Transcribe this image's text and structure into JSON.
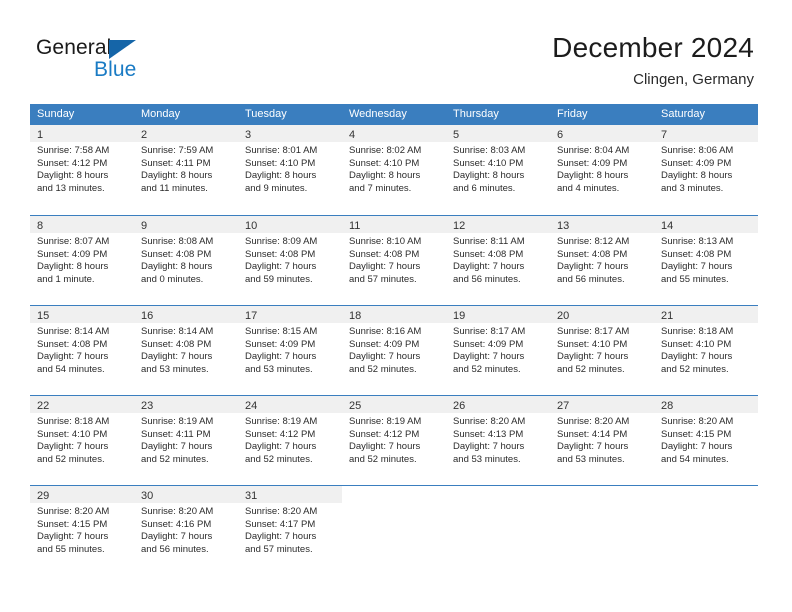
{
  "brand": {
    "name_part1": "General",
    "name_part2": "Blue",
    "triangle_icon": "triangle-icon",
    "color_dark": "#1a1a1a",
    "color_blue": "#1a7bc4"
  },
  "header": {
    "title": "December 2024",
    "subtitle": "Clingen, Germany"
  },
  "theme": {
    "header_bar": "#3a7ebf",
    "day_band": "#f0f0f0",
    "text": "#2b2b2b"
  },
  "weekdays": [
    "Sunday",
    "Monday",
    "Tuesday",
    "Wednesday",
    "Thursday",
    "Friday",
    "Saturday"
  ],
  "weeks": [
    [
      {
        "day": "1",
        "sunrise": "Sunrise: 7:58 AM",
        "sunset": "Sunset: 4:12 PM",
        "daylight1": "Daylight: 8 hours",
        "daylight2": "and 13 minutes."
      },
      {
        "day": "2",
        "sunrise": "Sunrise: 7:59 AM",
        "sunset": "Sunset: 4:11 PM",
        "daylight1": "Daylight: 8 hours",
        "daylight2": "and 11 minutes."
      },
      {
        "day": "3",
        "sunrise": "Sunrise: 8:01 AM",
        "sunset": "Sunset: 4:10 PM",
        "daylight1": "Daylight: 8 hours",
        "daylight2": "and 9 minutes."
      },
      {
        "day": "4",
        "sunrise": "Sunrise: 8:02 AM",
        "sunset": "Sunset: 4:10 PM",
        "daylight1": "Daylight: 8 hours",
        "daylight2": "and 7 minutes."
      },
      {
        "day": "5",
        "sunrise": "Sunrise: 8:03 AM",
        "sunset": "Sunset: 4:10 PM",
        "daylight1": "Daylight: 8 hours",
        "daylight2": "and 6 minutes."
      },
      {
        "day": "6",
        "sunrise": "Sunrise: 8:04 AM",
        "sunset": "Sunset: 4:09 PM",
        "daylight1": "Daylight: 8 hours",
        "daylight2": "and 4 minutes."
      },
      {
        "day": "7",
        "sunrise": "Sunrise: 8:06 AM",
        "sunset": "Sunset: 4:09 PM",
        "daylight1": "Daylight: 8 hours",
        "daylight2": "and 3 minutes."
      }
    ],
    [
      {
        "day": "8",
        "sunrise": "Sunrise: 8:07 AM",
        "sunset": "Sunset: 4:09 PM",
        "daylight1": "Daylight: 8 hours",
        "daylight2": "and 1 minute."
      },
      {
        "day": "9",
        "sunrise": "Sunrise: 8:08 AM",
        "sunset": "Sunset: 4:08 PM",
        "daylight1": "Daylight: 8 hours",
        "daylight2": "and 0 minutes."
      },
      {
        "day": "10",
        "sunrise": "Sunrise: 8:09 AM",
        "sunset": "Sunset: 4:08 PM",
        "daylight1": "Daylight: 7 hours",
        "daylight2": "and 59 minutes."
      },
      {
        "day": "11",
        "sunrise": "Sunrise: 8:10 AM",
        "sunset": "Sunset: 4:08 PM",
        "daylight1": "Daylight: 7 hours",
        "daylight2": "and 57 minutes."
      },
      {
        "day": "12",
        "sunrise": "Sunrise: 8:11 AM",
        "sunset": "Sunset: 4:08 PM",
        "daylight1": "Daylight: 7 hours",
        "daylight2": "and 56 minutes."
      },
      {
        "day": "13",
        "sunrise": "Sunrise: 8:12 AM",
        "sunset": "Sunset: 4:08 PM",
        "daylight1": "Daylight: 7 hours",
        "daylight2": "and 56 minutes."
      },
      {
        "day": "14",
        "sunrise": "Sunrise: 8:13 AM",
        "sunset": "Sunset: 4:08 PM",
        "daylight1": "Daylight: 7 hours",
        "daylight2": "and 55 minutes."
      }
    ],
    [
      {
        "day": "15",
        "sunrise": "Sunrise: 8:14 AM",
        "sunset": "Sunset: 4:08 PM",
        "daylight1": "Daylight: 7 hours",
        "daylight2": "and 54 minutes."
      },
      {
        "day": "16",
        "sunrise": "Sunrise: 8:14 AM",
        "sunset": "Sunset: 4:08 PM",
        "daylight1": "Daylight: 7 hours",
        "daylight2": "and 53 minutes."
      },
      {
        "day": "17",
        "sunrise": "Sunrise: 8:15 AM",
        "sunset": "Sunset: 4:09 PM",
        "daylight1": "Daylight: 7 hours",
        "daylight2": "and 53 minutes."
      },
      {
        "day": "18",
        "sunrise": "Sunrise: 8:16 AM",
        "sunset": "Sunset: 4:09 PM",
        "daylight1": "Daylight: 7 hours",
        "daylight2": "and 52 minutes."
      },
      {
        "day": "19",
        "sunrise": "Sunrise: 8:17 AM",
        "sunset": "Sunset: 4:09 PM",
        "daylight1": "Daylight: 7 hours",
        "daylight2": "and 52 minutes."
      },
      {
        "day": "20",
        "sunrise": "Sunrise: 8:17 AM",
        "sunset": "Sunset: 4:10 PM",
        "daylight1": "Daylight: 7 hours",
        "daylight2": "and 52 minutes."
      },
      {
        "day": "21",
        "sunrise": "Sunrise: 8:18 AM",
        "sunset": "Sunset: 4:10 PM",
        "daylight1": "Daylight: 7 hours",
        "daylight2": "and 52 minutes."
      }
    ],
    [
      {
        "day": "22",
        "sunrise": "Sunrise: 8:18 AM",
        "sunset": "Sunset: 4:10 PM",
        "daylight1": "Daylight: 7 hours",
        "daylight2": "and 52 minutes."
      },
      {
        "day": "23",
        "sunrise": "Sunrise: 8:19 AM",
        "sunset": "Sunset: 4:11 PM",
        "daylight1": "Daylight: 7 hours",
        "daylight2": "and 52 minutes."
      },
      {
        "day": "24",
        "sunrise": "Sunrise: 8:19 AM",
        "sunset": "Sunset: 4:12 PM",
        "daylight1": "Daylight: 7 hours",
        "daylight2": "and 52 minutes."
      },
      {
        "day": "25",
        "sunrise": "Sunrise: 8:19 AM",
        "sunset": "Sunset: 4:12 PM",
        "daylight1": "Daylight: 7 hours",
        "daylight2": "and 52 minutes."
      },
      {
        "day": "26",
        "sunrise": "Sunrise: 8:20 AM",
        "sunset": "Sunset: 4:13 PM",
        "daylight1": "Daylight: 7 hours",
        "daylight2": "and 53 minutes."
      },
      {
        "day": "27",
        "sunrise": "Sunrise: 8:20 AM",
        "sunset": "Sunset: 4:14 PM",
        "daylight1": "Daylight: 7 hours",
        "daylight2": "and 53 minutes."
      },
      {
        "day": "28",
        "sunrise": "Sunrise: 8:20 AM",
        "sunset": "Sunset: 4:15 PM",
        "daylight1": "Daylight: 7 hours",
        "daylight2": "and 54 minutes."
      }
    ],
    [
      {
        "day": "29",
        "sunrise": "Sunrise: 8:20 AM",
        "sunset": "Sunset: 4:15 PM",
        "daylight1": "Daylight: 7 hours",
        "daylight2": "and 55 minutes."
      },
      {
        "day": "30",
        "sunrise": "Sunrise: 8:20 AM",
        "sunset": "Sunset: 4:16 PM",
        "daylight1": "Daylight: 7 hours",
        "daylight2": "and 56 minutes."
      },
      {
        "day": "31",
        "sunrise": "Sunrise: 8:20 AM",
        "sunset": "Sunset: 4:17 PM",
        "daylight1": "Daylight: 7 hours",
        "daylight2": "and 57 minutes."
      },
      {
        "day": "",
        "sunrise": "",
        "sunset": "",
        "daylight1": "",
        "daylight2": ""
      },
      {
        "day": "",
        "sunrise": "",
        "sunset": "",
        "daylight1": "",
        "daylight2": ""
      },
      {
        "day": "",
        "sunrise": "",
        "sunset": "",
        "daylight1": "",
        "daylight2": ""
      },
      {
        "day": "",
        "sunrise": "",
        "sunset": "",
        "daylight1": "",
        "daylight2": ""
      }
    ]
  ]
}
